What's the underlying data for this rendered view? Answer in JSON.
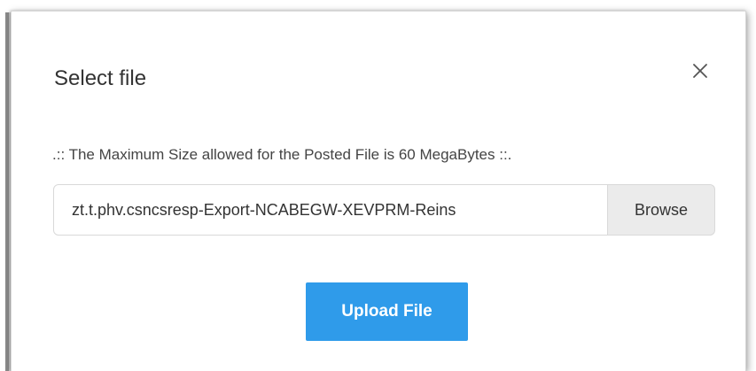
{
  "dialog": {
    "title": "Select file",
    "notice": ".:: The Maximum Size allowed for the Posted File is 60 MegaBytes ::.",
    "file_input_value": "zt.t.phv.csncsresp-Export-NCABEGW-XEVPRM-Reins",
    "browse_label": "Browse",
    "upload_label": "Upload File",
    "close_icon": "close-icon"
  },
  "colors": {
    "primary_button": "#2f9bea",
    "browse_button": "#ebebeb",
    "text": "#333333"
  }
}
